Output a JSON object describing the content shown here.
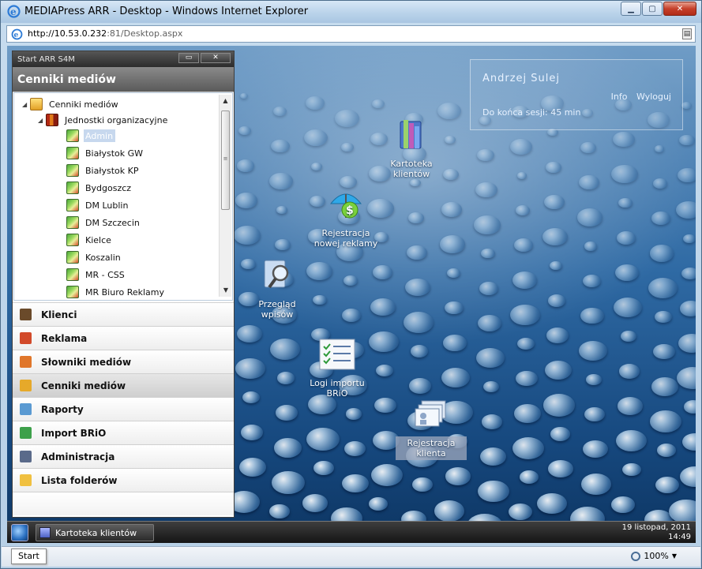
{
  "window": {
    "title": "MEDIAPress ARR - Desktop - Windows Internet Explorer",
    "address_host": "http://10.53.0.232",
    "address_rest": ":81/Desktop.aspx"
  },
  "panel": {
    "title": "Start ARR S4M",
    "min_glyph": "▭",
    "close_glyph": "✕",
    "header": "Cenniki mediów",
    "tree": {
      "root": "Cenniki mediów",
      "group": "Jednostki organizacyjne",
      "items": [
        "Admin",
        "Białystok GW",
        "Białystok KP",
        "Bydgoszcz",
        "DM Lublin",
        "DM Szczecin",
        "Kielce",
        "Koszalin",
        "MR - CSS",
        "MR Biuro Reklamy"
      ]
    },
    "menu": [
      {
        "label": "Klienci",
        "icon": "client-icon"
      },
      {
        "label": "Reklama",
        "icon": "advert-icon"
      },
      {
        "label": "Słowniki mediów",
        "icon": "dictionary-icon"
      },
      {
        "label": "Cenniki mediów",
        "icon": "pricelist-icon"
      },
      {
        "label": "Raporty",
        "icon": "report-icon"
      },
      {
        "label": "Import BRiO",
        "icon": "import-icon"
      },
      {
        "label": "Administracja",
        "icon": "admin-icon"
      },
      {
        "label": "Lista folderów",
        "icon": "folder-icon"
      }
    ]
  },
  "desktop_icons": [
    {
      "label1": "Kartoteka",
      "label2": "klientów",
      "icon": "client-file-icon"
    },
    {
      "label1": "Rejestracja",
      "label2": "nowej reklamy",
      "icon": "ad-registration-icon"
    },
    {
      "label1": "Przegląd",
      "label2": "wpisów",
      "icon": "magnifier-icon"
    },
    {
      "label1": "Logi importu",
      "label2": "BRiO",
      "icon": "checklist-icon"
    },
    {
      "label1": "Rejestracja",
      "label2": "klienta",
      "icon": "client-registration-icon"
    }
  ],
  "user": {
    "name": "Andrzej Sulej",
    "info": "Info",
    "logout": "Wyloguj",
    "session_label": "Do końca sesji:",
    "session_value": "45",
    "session_unit": "min"
  },
  "taskbar": {
    "task": "Kartoteka klientów",
    "date": "19 listopad, 2011",
    "time": "14:49"
  },
  "statusbar": {
    "start": "Start",
    "zoom": "100%"
  },
  "colors": {
    "desktop_top": "#6f9cc6",
    "desktop_bottom": "#0d3562",
    "panel_header": "#6f6f6f"
  }
}
